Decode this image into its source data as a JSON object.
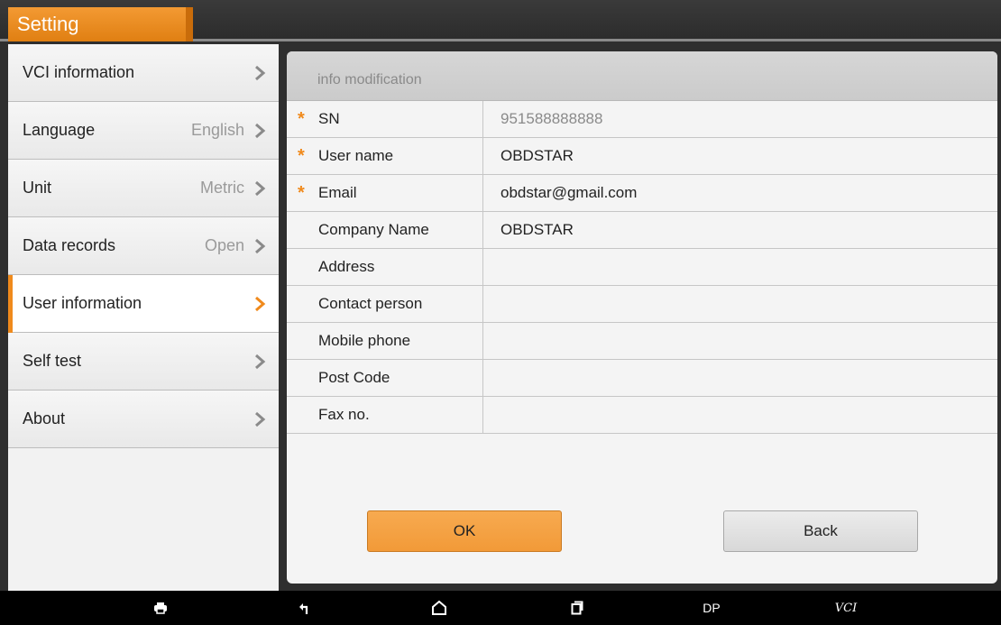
{
  "header": {
    "title": "Setting"
  },
  "sidebar": {
    "items": [
      {
        "label": "VCI information",
        "value": ""
      },
      {
        "label": "Language",
        "value": "English"
      },
      {
        "label": "Unit",
        "value": "Metric"
      },
      {
        "label": "Data records",
        "value": "Open"
      },
      {
        "label": "User information",
        "value": "",
        "active": true
      },
      {
        "label": "Self test",
        "value": ""
      },
      {
        "label": "About",
        "value": ""
      }
    ]
  },
  "form": {
    "title": "info modification",
    "required_mark": "*",
    "rows": [
      {
        "label": "SN",
        "required": true,
        "value": "951588888888"
      },
      {
        "label": "User name",
        "required": true,
        "value": "OBDSTAR"
      },
      {
        "label": "Email",
        "required": true,
        "value": "obdstar@gmail.com"
      },
      {
        "label": "Company Name",
        "required": false,
        "value": "OBDSTAR"
      },
      {
        "label": "Address",
        "required": false,
        "value": ""
      },
      {
        "label": "Contact person",
        "required": false,
        "value": ""
      },
      {
        "label": "Mobile phone",
        "required": false,
        "value": ""
      },
      {
        "label": "Post Code",
        "required": false,
        "value": ""
      },
      {
        "label": "Fax no.",
        "required": false,
        "value": ""
      }
    ],
    "ok_label": "OK",
    "back_label": "Back"
  },
  "navbar": {
    "icons": [
      "printer-icon",
      "back-icon",
      "home-icon",
      "recents-icon"
    ],
    "dp_label": "DP",
    "vci_label": "VCI"
  },
  "colors": {
    "accent": "#f08a1c",
    "header_bg": "#2f2f2f",
    "ok_button": "#f29a38"
  }
}
